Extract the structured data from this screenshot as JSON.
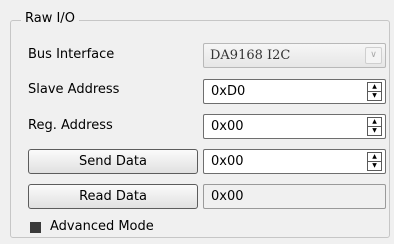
{
  "group": {
    "title": "Raw I/O"
  },
  "bus_interface": {
    "label": "Bus Interface",
    "value": "DA9168 I2C",
    "arrow_icon": "chevron-down-icon"
  },
  "slave_address": {
    "label": "Slave Address",
    "value": "0xD0"
  },
  "reg_address": {
    "label": "Reg. Address",
    "value": "0x00"
  },
  "send_data": {
    "button_label": "Send Data",
    "value": "0x00"
  },
  "read_data": {
    "button_label": "Read Data",
    "value": "0x00"
  },
  "advanced_mode": {
    "label": "Advanced Mode",
    "checked": true
  },
  "spin_icons": {
    "up": "▲",
    "down": "▼"
  }
}
